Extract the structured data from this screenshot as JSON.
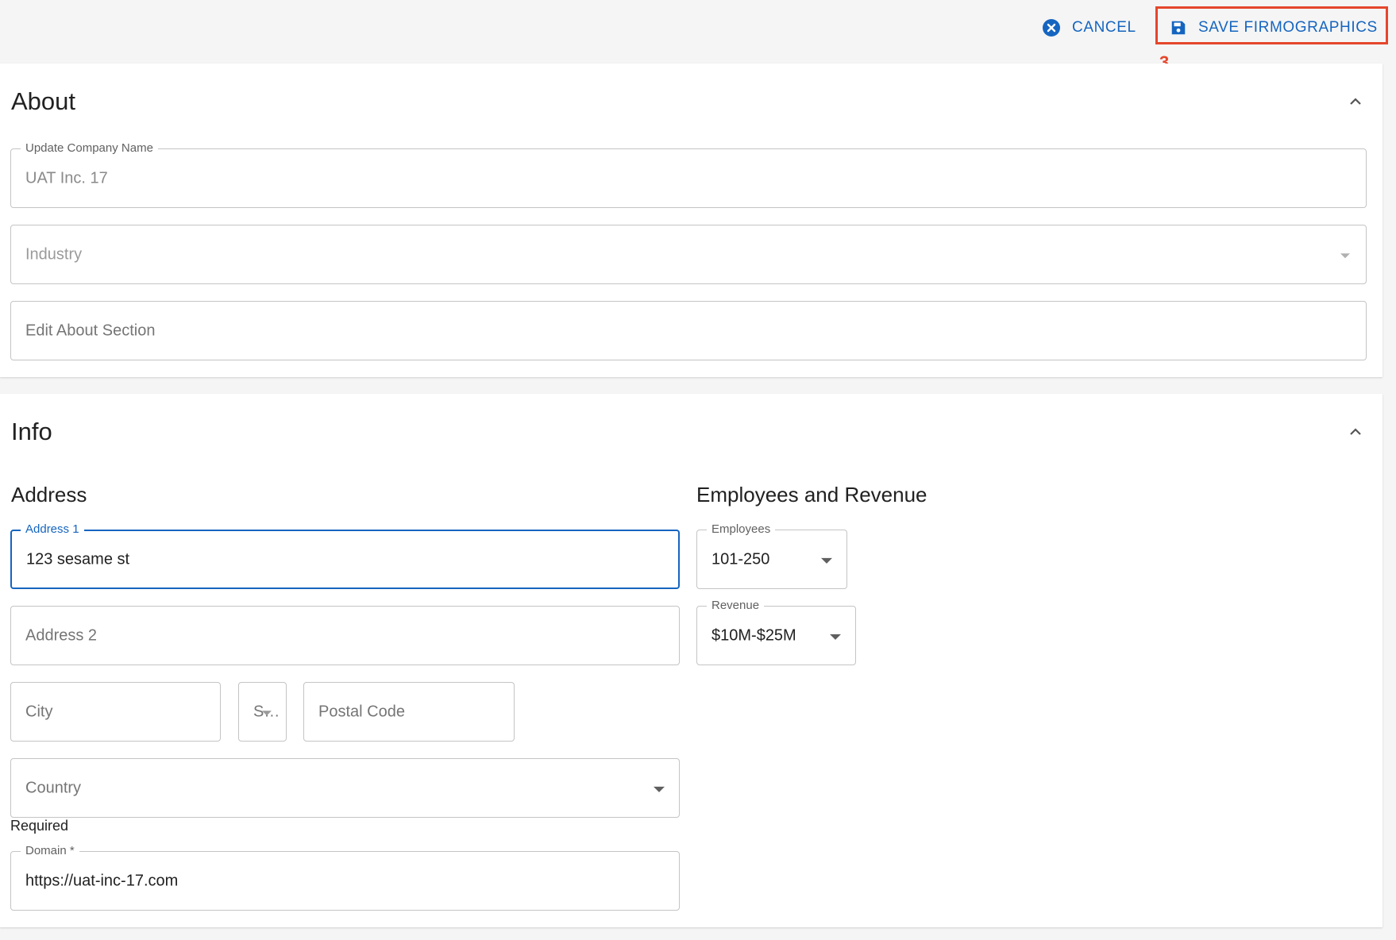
{
  "toolbar": {
    "cancel_label": "CANCEL",
    "save_label": "SAVE FIRMOGRAPHICS",
    "step_marker": "3.",
    "accent_color": "#1565c0",
    "highlight_color": "#e5462c"
  },
  "about": {
    "title": "About",
    "company_name": {
      "label": "Update Company Name",
      "value": "UAT Inc. 17"
    },
    "industry": {
      "placeholder": "Industry"
    },
    "about_section": {
      "placeholder": "Edit About Section"
    }
  },
  "info": {
    "title": "Info",
    "address": {
      "heading": "Address",
      "address1": {
        "label": "Address 1",
        "value": "123 sesame st"
      },
      "address2": {
        "placeholder": "Address 2"
      },
      "city": {
        "placeholder": "City"
      },
      "state": {
        "placeholder": "S…"
      },
      "postal_code": {
        "placeholder": "Postal Code"
      },
      "country": {
        "placeholder": "Country",
        "helper": "Required"
      },
      "domain": {
        "label": "Domain *",
        "value": "https://uat-inc-17.com"
      }
    },
    "employees_revenue": {
      "heading": "Employees and Revenue",
      "employees": {
        "label": "Employees",
        "value": "101-250"
      },
      "revenue": {
        "label": "Revenue",
        "value": "$10M-$25M"
      }
    }
  }
}
